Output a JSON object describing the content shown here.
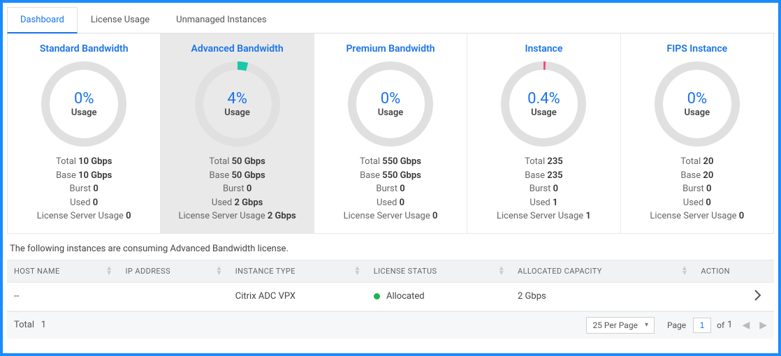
{
  "tabs": [
    {
      "label": "Dashboard",
      "active": true
    },
    {
      "label": "License Usage",
      "active": false
    },
    {
      "label": "Unmanaged Instances",
      "active": false
    }
  ],
  "cards": [
    {
      "title": "Standard Bandwidth",
      "pct": "0%",
      "usage_label": "Usage",
      "selected": false,
      "arc_color": "#e0e0e0",
      "arc_frac": 0,
      "total_label": "Total",
      "total_val": "10 Gbps",
      "base_label": "Base",
      "base_val": "10 Gbps",
      "burst_label": "Burst",
      "burst_val": "0",
      "used_label": "Used",
      "used_val": "0",
      "lsu_label": "License Server Usage",
      "lsu_val": "0"
    },
    {
      "title": "Advanced Bandwidth",
      "pct": "4%",
      "usage_label": "Usage",
      "selected": true,
      "arc_color": "#1bc7aa",
      "arc_frac": 0.04,
      "total_label": "Total",
      "total_val": "50 Gbps",
      "base_label": "Base",
      "base_val": "50 Gbps",
      "burst_label": "Burst",
      "burst_val": "0",
      "used_label": "Used",
      "used_val": "2 Gbps",
      "lsu_label": "License Server Usage",
      "lsu_val": "2 Gbps"
    },
    {
      "title": "Premium Bandwidth",
      "pct": "0%",
      "usage_label": "Usage",
      "selected": false,
      "arc_color": "#e0e0e0",
      "arc_frac": 0,
      "total_label": "Total",
      "total_val": "550 Gbps",
      "base_label": "Base",
      "base_val": "550 Gbps",
      "burst_label": "Burst",
      "burst_val": "0",
      "used_label": "Used",
      "used_val": "0",
      "lsu_label": "License Server Usage",
      "lsu_val": "0"
    },
    {
      "title": "Instance",
      "pct": "0.4%",
      "usage_label": "Usage",
      "selected": false,
      "arc_color": "#e94f7a",
      "arc_frac": 0.004,
      "total_label": "Total",
      "total_val": "235",
      "base_label": "Base",
      "base_val": "235",
      "burst_label": "Burst",
      "burst_val": "0",
      "used_label": "Used",
      "used_val": "1",
      "lsu_label": "License Server Usage",
      "lsu_val": "1"
    },
    {
      "title": "FIPS Instance",
      "pct": "0%",
      "usage_label": "Usage",
      "selected": false,
      "arc_color": "#e0e0e0",
      "arc_frac": 0,
      "total_label": "Total",
      "total_val": "20",
      "base_label": "Base",
      "base_val": "20",
      "burst_label": "Burst",
      "burst_val": "0",
      "used_label": "Used",
      "used_val": "0",
      "lsu_label": "License Server Usage",
      "lsu_val": "0"
    }
  ],
  "description": "The following instances are consuming Advanced Bandwidth license.",
  "table": {
    "headers": [
      "HOST NAME",
      "IP ADDRESS",
      "INSTANCE TYPE",
      "LICENSE STATUS",
      "ALLOCATED CAPACITY",
      "ACTION"
    ],
    "rows": [
      {
        "host": "--",
        "ip": "",
        "type": "Citrix ADC VPX",
        "status": "Allocated",
        "status_dot": "#1fb254",
        "capacity": "2 Gbps"
      }
    ]
  },
  "footer": {
    "total_label": "Total",
    "total_val": "1",
    "per_page": "25 Per Page",
    "page_label": "Page",
    "page_val": "1",
    "of_label": "of",
    "of_val": "1"
  }
}
